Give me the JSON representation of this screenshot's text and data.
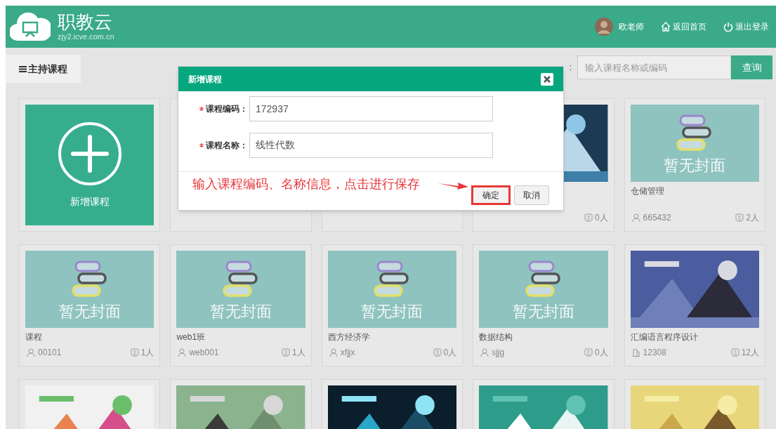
{
  "header": {
    "logo_title": "职教云",
    "logo_subtitle": "zjy2.icve.com.cn",
    "user_name": "欧老师",
    "links": [
      {
        "kind": "home",
        "label": "返回首页"
      },
      {
        "kind": "power",
        "label": "退出登录"
      }
    ]
  },
  "tabs": [
    {
      "label": "主持课程",
      "selected": true
    }
  ],
  "search": {
    "label_fragment": ":",
    "placeholder": "输入课程名称或编码",
    "button": "查询"
  },
  "add_card": {
    "label": "新增课程"
  },
  "courses": [
    {
      "kind": "blank"
    },
    {
      "kind": "blank"
    },
    {
      "kind": "picture",
      "count": "0人"
    },
    {
      "kind": "no_cover",
      "cover_text": "暂无封面",
      "title": "仓储管理",
      "owner": {
        "kind": "user",
        "code": "665432"
      },
      "count": "2人"
    },
    {
      "kind": "no_cover",
      "cover_text": "暂无封面",
      "title": "课程",
      "owner": {
        "kind": "user",
        "code": "00101"
      },
      "count": "1人"
    },
    {
      "kind": "no_cover",
      "cover_text": "暂无封面",
      "title": "web1班",
      "owner": {
        "kind": "user",
        "code": "web001"
      },
      "count": "1人"
    },
    {
      "kind": "no_cover",
      "cover_text": "暂无封面",
      "title": "西方经济学",
      "owner": {
        "kind": "user",
        "code": "xfjjx"
      },
      "count": "0人"
    },
    {
      "kind": "no_cover",
      "cover_text": "暂无封面",
      "title": "数据结构",
      "owner": {
        "kind": "user",
        "code": "sjjg"
      },
      "count": "0人"
    },
    {
      "kind": "picture",
      "title": "汇编语言程序设计",
      "owner": {
        "kind": "building",
        "code": "12308"
      },
      "count": "12人"
    },
    {
      "kind": "picture"
    },
    {
      "kind": "picture"
    },
    {
      "kind": "picture"
    },
    {
      "kind": "picture"
    },
    {
      "kind": "picture"
    }
  ],
  "dialog": {
    "title": "新增课程",
    "fields": [
      {
        "required": true,
        "label": "课程编码：",
        "value": "172937"
      },
      {
        "required": true,
        "label": "课程名称：",
        "value": "线性代数"
      }
    ],
    "annotation": "输入课程编码、名称信息，点击进行保存",
    "buttons": [
      {
        "label": "确定",
        "highlighted": true
      },
      {
        "label": "取消",
        "highlighted": false
      }
    ]
  }
}
